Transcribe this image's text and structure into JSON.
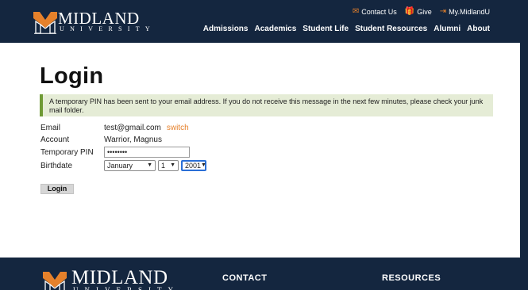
{
  "brand": {
    "name": "MIDLAND",
    "sub": "UNIVERSITY",
    "accent": "#e6812b",
    "navy": "#14263f"
  },
  "utility": [
    {
      "icon": "mail-icon",
      "glyph": "✉",
      "label": "Contact Us"
    },
    {
      "icon": "gift-icon",
      "glyph": "🎁",
      "label": "Give"
    },
    {
      "icon": "sign-in-icon",
      "glyph": "⇥",
      "label": "My.MidlandU"
    }
  ],
  "nav": [
    "Admissions",
    "Academics",
    "Student Life",
    "Student Resources",
    "Alumni",
    "About"
  ],
  "page": {
    "title": "Login"
  },
  "notice": "A temporary PIN has been sent to your email address. If you do not receive this message in the next few minutes, please check your junk mail folder.",
  "form": {
    "email_label": "Email",
    "email_value": "test@gmail.com",
    "switch_label": "switch",
    "account_label": "Account",
    "account_value": "Warrior, Magnus",
    "pin_label": "Temporary PIN",
    "pin_value": "••••••••",
    "birthdate_label": "Birthdate",
    "month": "January",
    "day": "1",
    "year": "2001",
    "submit_label": "Login"
  },
  "footer": {
    "contact_heading": "CONTACT",
    "resources_heading": "RESOURCES"
  }
}
